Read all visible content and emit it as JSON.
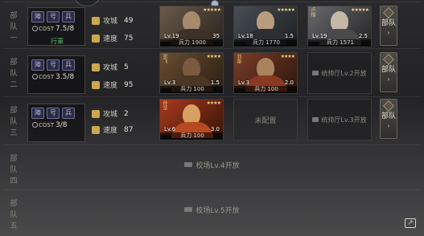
{
  "rows": [
    {
      "label": "部队一",
      "badges": [
        "陣",
        "号",
        "兵"
      ],
      "cost_label": "COST",
      "cost_value": "7.5/8",
      "status": "行軍",
      "siege_label": "攻城",
      "siege_value": "49",
      "speed_label": "速度",
      "speed_value": "75",
      "slots": [
        {
          "stars": "★★★★★",
          "lv": "Lv.19",
          "cost": "35",
          "troops": "兵力 1900",
          "badge": ""
        },
        {
          "stars": "★★★★★",
          "lv": "Lv.18",
          "cost": "1.5",
          "troops": "兵力 1770",
          "badge": ""
        },
        {
          "stars": "★★★★★",
          "lv": "Lv.19",
          "cost": "2.5",
          "troops": "兵力 1571",
          "badge": "卢植"
        }
      ],
      "side_button": "部队"
    },
    {
      "label": "部队二",
      "badges": [
        "陣",
        "号",
        "兵"
      ],
      "cost_label": "COST",
      "cost_value": "3.5/8",
      "status": "",
      "siege_label": "攻城",
      "siege_value": "5",
      "speed_label": "速度",
      "speed_value": "95",
      "slots": [
        {
          "stars": "★★★★",
          "lv": "Lv.3",
          "cost": "1.5",
          "troops": "兵力 100",
          "badge": "张飞"
        },
        {
          "stars": "★★★★",
          "lv": "Lv.3",
          "cost": "2.0",
          "troops": "兵力 100",
          "badge": "刘备"
        }
      ],
      "locked_slot": "统帅厅Lv.2开放",
      "side_button": "部队"
    },
    {
      "label": "部队三",
      "badges": [
        "陣",
        "号",
        "兵"
      ],
      "cost_label": "COST",
      "cost_value": "3/8",
      "status": "",
      "siege_label": "攻城",
      "siege_value": "2",
      "speed_label": "速度",
      "speed_value": "87",
      "slots": [
        {
          "stars": "★★★★",
          "lv": "Lv.6",
          "cost": "3.0",
          "troops": "兵力 100",
          "badge": "孙坚"
        }
      ],
      "unassigned": "未配置",
      "locked_slot": "统帅厅Lv.3开放",
      "side_button": "部队"
    },
    {
      "label": "部队四",
      "locked_text": "校场Lv.4开放"
    },
    {
      "label": "部队五",
      "locked_text": "校场Lv.5开放"
    }
  ],
  "colors": {
    "accent_gold": "#c9a94d",
    "status_green": "#5fb86a"
  }
}
